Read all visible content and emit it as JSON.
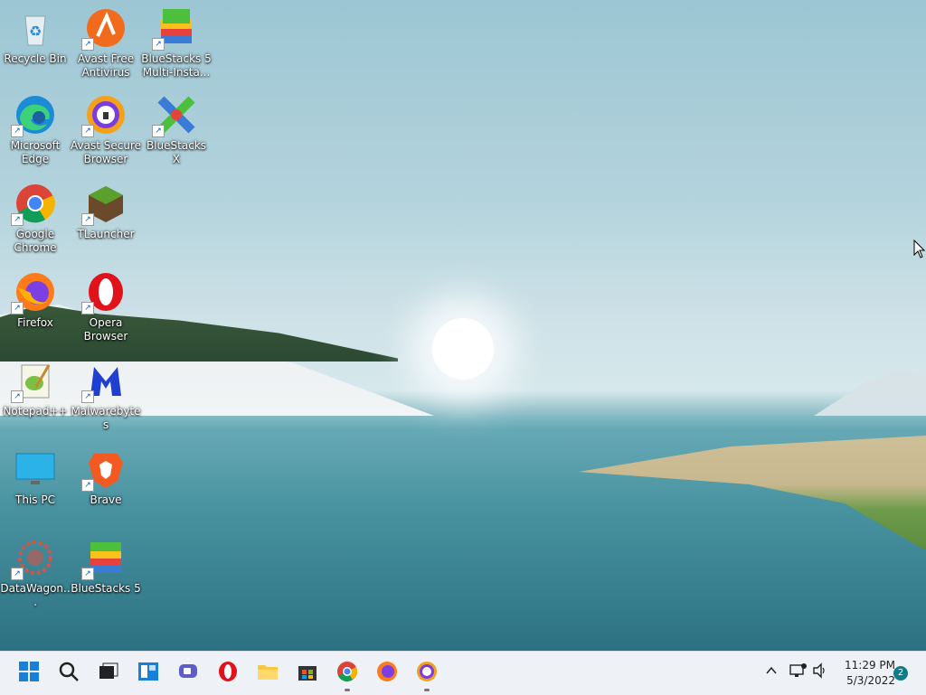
{
  "desktop": {
    "icons": [
      {
        "label": "Recycle Bin",
        "icon": "recycle-bin-icon",
        "shortcut": false
      },
      {
        "label": "Avast Free Antivirus",
        "icon": "avast-antivirus-icon",
        "shortcut": true
      },
      {
        "label": "BlueStacks 5 Multi-Insta...",
        "icon": "bluestacks-multi-icon",
        "shortcut": true
      },
      {
        "label": "Microsoft Edge",
        "icon": "edge-icon",
        "shortcut": true
      },
      {
        "label": "Avast Secure Browser",
        "icon": "avast-browser-icon",
        "shortcut": true
      },
      {
        "label": "BlueStacks X",
        "icon": "bluestacks-x-icon",
        "shortcut": true
      },
      {
        "label": "Google Chrome",
        "icon": "chrome-icon",
        "shortcut": true
      },
      {
        "label": "TLauncher",
        "icon": "tlauncher-icon",
        "shortcut": true
      },
      {
        "label": "Firefox",
        "icon": "firefox-icon",
        "shortcut": true
      },
      {
        "label": "Opera Browser",
        "icon": "opera-icon",
        "shortcut": true
      },
      {
        "label": "Notepad++",
        "icon": "notepad-plus-plus-icon",
        "shortcut": true
      },
      {
        "label": "Malwarebytes",
        "icon": "malwarebytes-icon",
        "shortcut": true
      },
      {
        "label": "This PC",
        "icon": "this-pc-icon",
        "shortcut": false
      },
      {
        "label": "Brave",
        "icon": "brave-icon",
        "shortcut": true
      },
      {
        "label": "DataWagon...",
        "icon": "datawagon-icon",
        "shortcut": true
      },
      {
        "label": "BlueStacks 5",
        "icon": "bluestacks-5-icon",
        "shortcut": true
      }
    ]
  },
  "taskbar": {
    "apps": [
      {
        "icon": "start-icon",
        "running": false
      },
      {
        "icon": "search-icon",
        "running": false
      },
      {
        "icon": "task-view-icon",
        "running": false
      },
      {
        "icon": "widgets-icon",
        "running": false
      },
      {
        "icon": "teams-chat-icon",
        "running": false
      },
      {
        "icon": "opera-icon",
        "running": false
      },
      {
        "icon": "file-explorer-icon",
        "running": false
      },
      {
        "icon": "microsoft-store-icon",
        "running": false
      },
      {
        "icon": "chrome-icon",
        "running": true
      },
      {
        "icon": "firefox-icon",
        "running": false
      },
      {
        "icon": "avast-browser-icon",
        "running": true
      }
    ],
    "tray": {
      "time": "11:29 PM",
      "date": "5/3/2022",
      "notifications": "2"
    }
  }
}
